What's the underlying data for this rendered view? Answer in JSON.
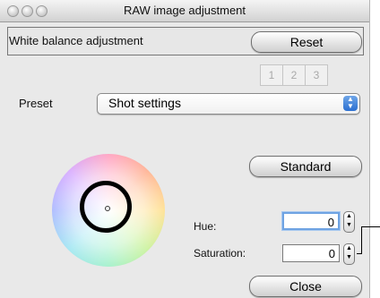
{
  "window": {
    "title": "RAW image adjustment"
  },
  "white_balance": {
    "group_label": "White balance adjustment",
    "reset_label": "Reset"
  },
  "presets_tabs": [
    "1",
    "2",
    "3"
  ],
  "preset": {
    "label": "Preset",
    "value": "Shot settings"
  },
  "standard_label": "Standard",
  "hue": {
    "label": "Hue:",
    "value": "0"
  },
  "saturation": {
    "label": "Saturation:",
    "value": "0"
  },
  "close_label": "Close",
  "icons": {
    "traffic_lights": "window-control-icons",
    "select_arrows": "up-down-arrows-icon",
    "stepper": "stepper-arrows-icon"
  },
  "colors": {
    "focus_ring": "#6fa3e2",
    "select_accent": "#2b6fd1"
  }
}
